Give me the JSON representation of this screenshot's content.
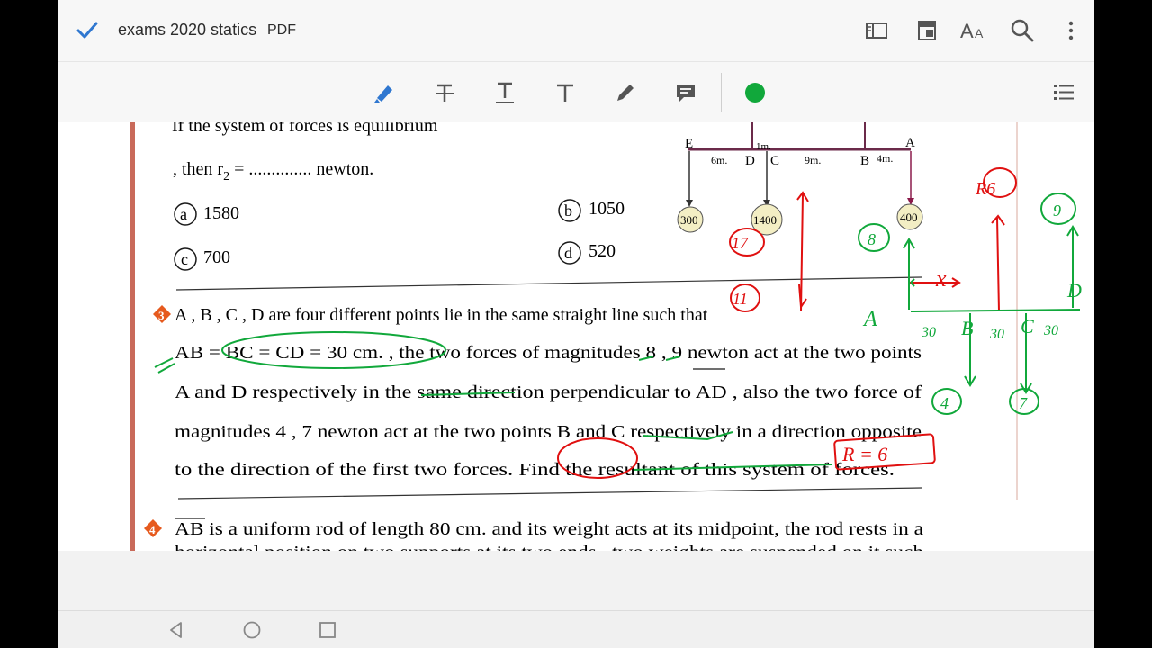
{
  "app": {
    "doc_title": "exams 2020 statics",
    "doc_type": "PDF"
  },
  "topbar_icons": [
    "checkmark-icon",
    "panel-icon",
    "bookmark-icon",
    "text-size-icon",
    "search-icon",
    "more-vert-icon"
  ],
  "toolbar": {
    "tools": [
      "highlighter-icon",
      "strikethrough-icon",
      "underline-icon",
      "text-icon",
      "pencil-icon",
      "comment-icon",
      "color-dot-icon",
      "list-icon"
    ],
    "active_color": "#11a83b",
    "accent": "#2f77d0"
  },
  "pdf": {
    "q2_line1": "If the system of forces is equilibrium",
    "q2_line2_prefix": ", then r",
    "q2_line2_sub": "2",
    "q2_line2_suffix": " = .............. newton.",
    "options": [
      {
        "letter": "a",
        "value": "1580"
      },
      {
        "letter": "b",
        "value": "1050"
      },
      {
        "letter": "c",
        "value": "700"
      },
      {
        "letter": "d",
        "value": "520"
      }
    ],
    "diagram": {
      "labels": [
        "E",
        "D",
        "C",
        "B",
        "A"
      ],
      "dims": [
        "6m.",
        "1m.",
        "9m.",
        "4m."
      ],
      "weights": [
        "300",
        "1400",
        "400"
      ]
    },
    "q3": {
      "number": "3",
      "lines": [
        "A , B , C , D are four different points lie in the same straight line such that",
        "AB = BC = CD = 30 cm. , the two forces of magnitudes 8 , 9 newton act at the two points",
        "A and D respectively in the same direction perpendicular to AD , also the two force of",
        "magnitudes 4 , 7 newton act at the two points B and C respectively in a direction opposite",
        "to the direction of the first two forces. Find the resultant of this system of forces."
      ]
    },
    "q4": {
      "number": "4",
      "line1": "AB is a uniform rod of length 80 cm. and its weight acts at its midpoint, the rod rests in a",
      "line2": "horizontal position on two supports at its two ends , two weights are suspended on it such"
    },
    "handwriting": {
      "red": [
        "17",
        "11",
        "R6",
        "R = 6"
      ],
      "green": [
        "8",
        "9",
        "4",
        "7",
        "A",
        "B",
        "C",
        "D",
        "x",
        "30",
        "30",
        "30"
      ]
    }
  },
  "navbar_icons": [
    "back-icon",
    "home-icon",
    "recents-icon"
  ]
}
